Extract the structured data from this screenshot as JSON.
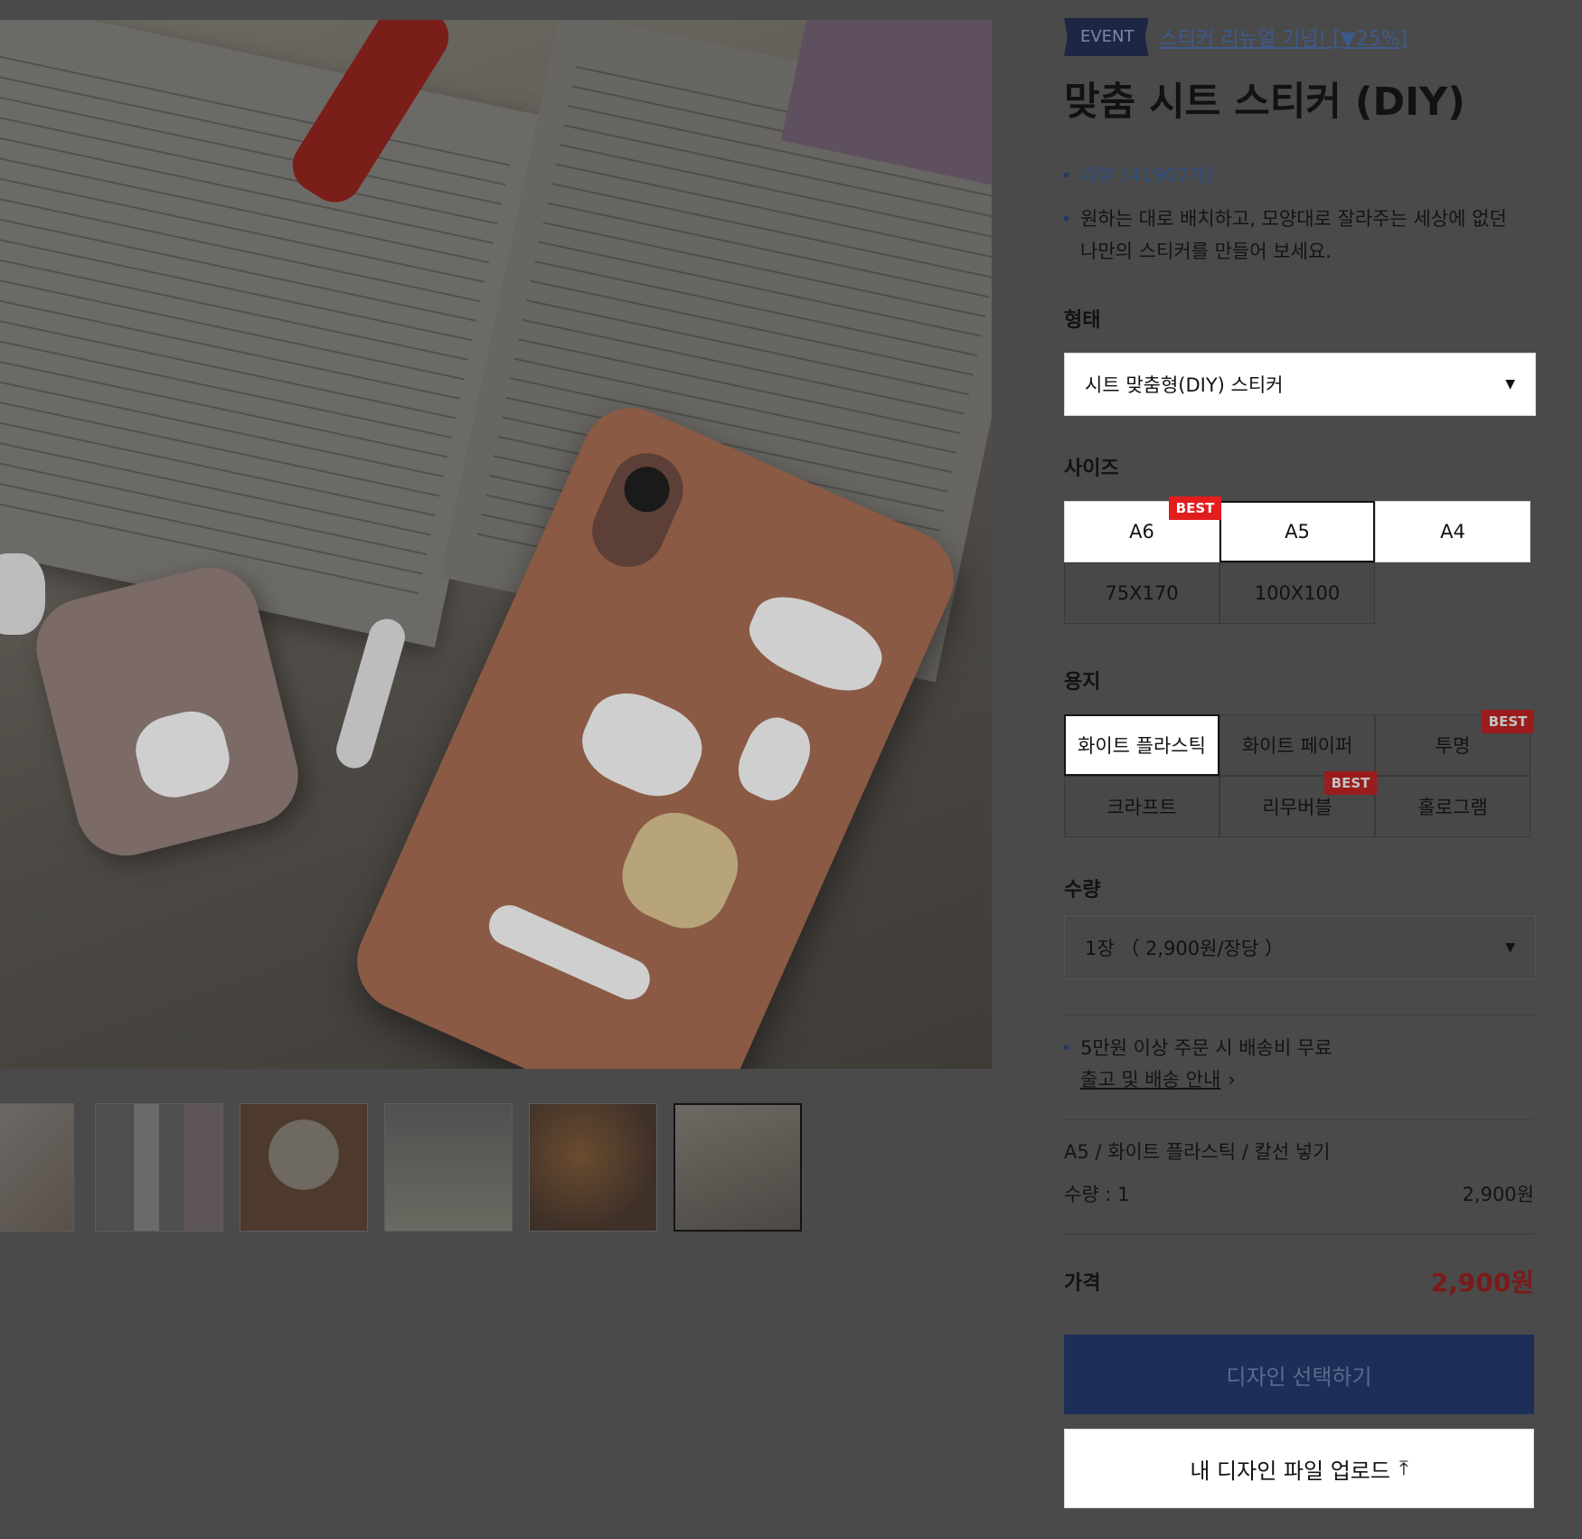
{
  "event": {
    "badge": "EVENT",
    "link_text": "스티커 리뉴얼 기념! [▼25%]"
  },
  "product": {
    "title": "맞춤 시트 스티커 (DIY)",
    "review_text": "리뷰 (41907개)",
    "description_line1": "원하는 대로 배치하고, 모양대로 잘라주는 세상에 없던",
    "description_line2": "나만의 스티커를 만들어 보세요."
  },
  "form": {
    "label": "형태",
    "selected": "시트 맞춤형(DIY) 스티커"
  },
  "size": {
    "label": "사이즈",
    "options": [
      "A6",
      "A5",
      "A4",
      "75X170",
      "100X100"
    ],
    "selected": "A5",
    "best": "A6"
  },
  "paper": {
    "label": "용지",
    "options": [
      "화이트 플라스틱",
      "화이트 페이퍼",
      "투명",
      "크라프트",
      "리무버블",
      "홀로그램"
    ],
    "selected": "화이트 플라스틱",
    "best": [
      "투명",
      "리무버블"
    ]
  },
  "best_label": "BEST",
  "quantity": {
    "label": "수량",
    "selected": "1장 （ 2,900원/장당 ）"
  },
  "shipping": {
    "notice": "5만원 이상 주문 시 배송비 무료",
    "link": "출고 및 배송 안내"
  },
  "summary": {
    "options_text": "A5 / 화이트 플라스틱 / 칼선 넣기",
    "qty_text": "수량 : 1",
    "line_price": "2,900원"
  },
  "price": {
    "label": "가격",
    "value": "2,900원"
  },
  "buttons": {
    "design_select": "디자인 선택하기",
    "upload": "내 디자인 파일 업로드"
  },
  "colors": {
    "overlay": "#4a4a4a",
    "accent_navy": "#1d2e58",
    "price_red": "#7c1919",
    "best_red": "#e21d1d"
  },
  "icons": {
    "select_arrow": "triangle-down-icon",
    "upload": "upload-arrow-icon",
    "chevron": "chevron-right-icon"
  }
}
